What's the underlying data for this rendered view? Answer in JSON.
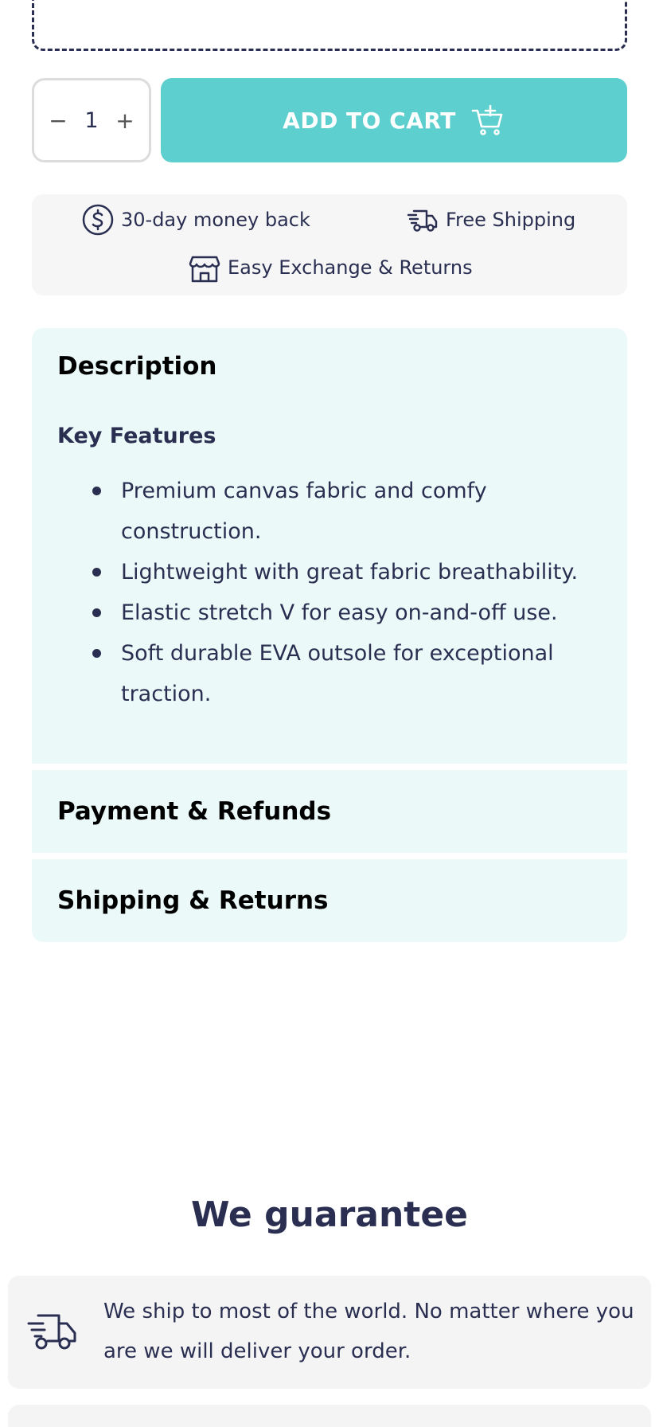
{
  "quantity": {
    "minus": "−",
    "value": "1",
    "plus": "+"
  },
  "cart": {
    "label": "ADD TO CART"
  },
  "perks": [
    {
      "label": "30-day money back",
      "icon": "dollar-circle-icon"
    },
    {
      "label": "Free Shipping",
      "icon": "truck-icon"
    },
    {
      "label": "Easy Exchange & Returns",
      "icon": "storefront-icon"
    }
  ],
  "description": {
    "title": "Description",
    "subtitle": "Key Features",
    "features": [
      "Premium canvas fabric and comfy construction.",
      "Lightweight with great fabric breathability.",
      "Elastic stretch V for easy on-and-off use.",
      "Soft durable EVA outsole for exceptional traction."
    ]
  },
  "payment": {
    "title": "Payment & Refunds"
  },
  "shipping": {
    "title": "Shipping & Returns"
  },
  "guarantee": {
    "title": "We guarantee",
    "items": [
      {
        "icon": "truck-icon",
        "text": "We ship to most of the world. No matter where you are we will deliver your order."
      }
    ]
  },
  "colors": {
    "accent": "#5ccfce",
    "text": "#2a2f52",
    "panel": "#ebfaf8"
  }
}
